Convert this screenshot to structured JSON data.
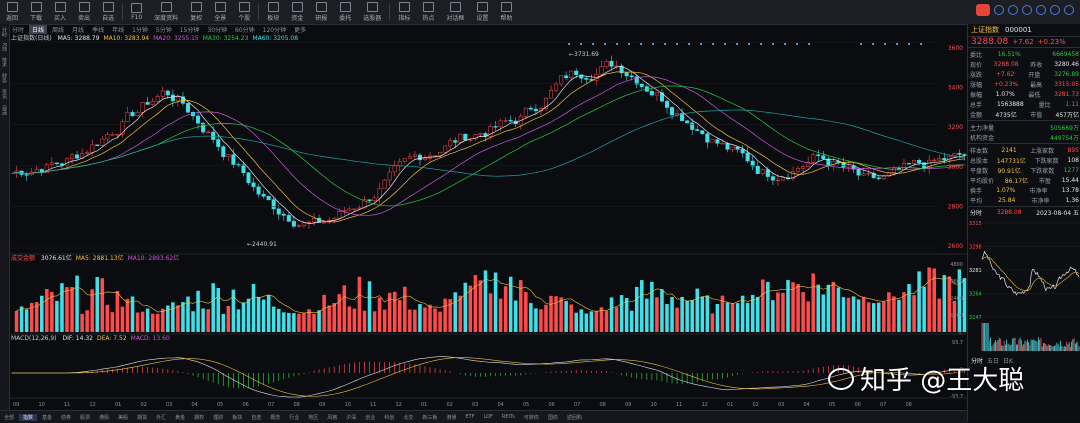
{
  "colors": {
    "up": "#ff4b4b",
    "down": "#28c840",
    "cyan": "#3fe0e8",
    "yellow": "#f3c13c",
    "white": "#e4e6ea",
    "purple": "#c85ad8",
    "teal": "#1fa3a3"
  },
  "toolbar": {
    "buttons": [
      "返回",
      "下载",
      "买入",
      "卖出",
      "自选",
      "F10",
      "深度资料",
      "复权",
      "全景",
      "个股",
      "板块",
      "资金",
      "研报",
      "委托",
      "选股器",
      "指标",
      "热点",
      "对话框",
      "设置",
      "帮助"
    ],
    "right_icons": [
      "search-icon",
      "user-icon",
      "mail-icon",
      "settings-icon",
      "minimize-icon",
      "close-icon"
    ]
  },
  "left_strip_labels": [
    "分时",
    "K线",
    "技术",
    "财务",
    "资讯",
    "自选"
  ],
  "periods": [
    "分时",
    "日线",
    "周线",
    "月线",
    "季线",
    "年线",
    "1分钟",
    "5分钟",
    "15分钟",
    "30分钟",
    "60分钟",
    "120分钟",
    "更多"
  ],
  "active_period": 1,
  "main_info": {
    "name": "上证指数(日线)",
    "ma": [
      {
        "label": "MA5: 3288.79",
        "color": "#e4e6ea"
      },
      {
        "label": "MA10: 3283.94",
        "color": "#f3c13c"
      },
      {
        "label": "MA20: 3255.15",
        "color": "#c85ad8"
      },
      {
        "label": "MA30: 3254.23",
        "color": "#28c840"
      },
      {
        "label": "MA60: 3205.08",
        "color": "#3fe0e8"
      }
    ]
  },
  "annotations": {
    "high": "3731.69",
    "low": "2440.91"
  },
  "price_axis": [
    "3600",
    "3400",
    "3200",
    "3000",
    "2800",
    "2600"
  ],
  "volume_info": {
    "label": "成交金额",
    "vals": [
      {
        "label": "3076.61亿",
        "color": "#e4e6ea"
      },
      {
        "label": "MA5: 2881.13亿",
        "color": "#f3c13c"
      },
      {
        "label": "MA10: 2893.62亿",
        "color": "#c85ad8"
      }
    ],
    "axis": [
      "4800",
      "3600",
      "2400",
      "1200",
      "亿"
    ]
  },
  "macd_info": {
    "label": "MACD(12,26,9)",
    "vals": [
      {
        "label": "DIF: 14.32",
        "color": "#e4e6ea"
      },
      {
        "label": "DEA: 7.52",
        "color": "#f3c13c"
      },
      {
        "label": "MACD: 13.60",
        "color": "#c85ad8"
      }
    ],
    "axis": [
      "93.7",
      "0",
      "-93.7"
    ]
  },
  "time_axis": [
    "09",
    "10",
    "11",
    "12",
    "01",
    "02",
    "03",
    "04",
    "05",
    "06",
    "07",
    "08",
    "09",
    "10",
    "11",
    "12",
    "01",
    "02",
    "03",
    "04",
    "05",
    "06",
    "07",
    "08",
    "09",
    "10",
    "11",
    "12",
    "01",
    "02",
    "03",
    "04",
    "05",
    "06",
    "07",
    "08"
  ],
  "bottom_tabs": [
    "全部",
    "指数",
    "基金",
    "债券",
    "股票",
    "港股",
    "美股",
    "期货",
    "外汇",
    "黄金",
    "期权",
    "理财",
    "板块",
    "自选",
    "概念",
    "行业",
    "地区",
    "风格",
    "沪深",
    "创业",
    "科创",
    "北交",
    "新三板",
    "港通",
    "ETF",
    "LOF",
    "REITs",
    "可转债",
    "国债",
    "逆回购"
  ],
  "active_bottom_tab": 1,
  "panel": {
    "title": "上证指数",
    "code": "000001",
    "price": "3288.08",
    "change": "+7.62",
    "change_pct": "+0.23%",
    "stats": [
      {
        "l": "委比",
        "v": "16.51%",
        "c": "dn",
        "l2": "",
        "v2": "6669458",
        "c2": "dn"
      },
      {
        "l": "现价",
        "v": "3288.08",
        "c": "up",
        "l2": "昨收",
        "v2": "3280.46",
        "c2": "wh"
      },
      {
        "l": "涨跌",
        "v": "+7.62",
        "c": "up",
        "l2": "开盘",
        "v2": "3276.89",
        "c2": "dn"
      },
      {
        "l": "涨幅",
        "v": "+0.23%",
        "c": "up",
        "l2": "最高",
        "v2": "3315.05",
        "c2": "up"
      },
      {
        "l": "振幅",
        "v": "1.07%",
        "c": "wh",
        "l2": "最低",
        "v2": "3281.73",
        "c2": "up"
      },
      {
        "l": "总手",
        "v": "1563888",
        "c": "wh",
        "l2": "量比",
        "v2": "1.11",
        "c2": "up"
      },
      {
        "l": "金额",
        "v": "4735亿",
        "c": "wh",
        "l2": "市值",
        "v2": "457万亿",
        "c2": "wh"
      }
    ],
    "flow": [
      {
        "l": "主力净量",
        "v": "505669万",
        "c": "dn"
      },
      {
        "l": "机构资金",
        "v": "449754万",
        "c": "dn"
      }
    ],
    "breadth": [
      {
        "l": "样本数",
        "v": "2141",
        "l2": "上涨家数",
        "v2": "895",
        "c2": "up"
      },
      {
        "l": "总股本",
        "v": "147731亿",
        "l2": "下跌家数",
        "v2": "108",
        "c2": "wh"
      },
      {
        "l": "平盘数",
        "v": "90.91亿",
        "l2": "下跌家数",
        "v2": "1277",
        "c2": "dn"
      },
      {
        "l": "平均股价",
        "v": "86.17亿",
        "l2": "市盈",
        "v2": "15.44",
        "c2": "wh"
      },
      {
        "l": "换手",
        "v": "1.07%",
        "l2": "市净率",
        "v2": "13.78",
        "c2": "wh"
      },
      {
        "l": "平均",
        "v": "25.84",
        "l2": "市净率",
        "v2": "1.36",
        "c2": "wh"
      }
    ],
    "mini_title": "分时",
    "mini_price": "3288.08",
    "mini_date": "2023-08-04 五",
    "mini_axis": [
      "3315",
      "3298",
      "3281",
      "3264",
      "3247"
    ],
    "mini_tabs": [
      "分时",
      "五日",
      "日K"
    ]
  },
  "watermark": "知乎 @王大聪"
}
